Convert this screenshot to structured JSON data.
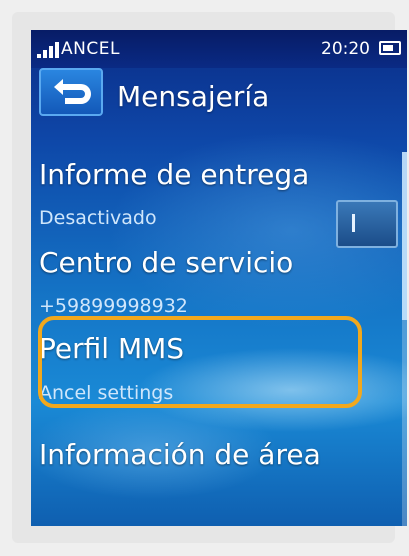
{
  "status_bar": {
    "carrier": "ANCEL",
    "time": "20:20",
    "signal_icon": "signal-bars-icon",
    "battery_icon": "battery-icon"
  },
  "header": {
    "title": "Mensajería",
    "back_icon": "back-arrow-icon"
  },
  "settings": [
    {
      "title": "Informe de entrega",
      "value": "Desactivado",
      "has_toggle": true
    },
    {
      "title": "Centro de servicio",
      "value": "+59899998932"
    },
    {
      "title": "Perfil MMS",
      "value": "Ancel settings",
      "highlighted": true
    },
    {
      "title": "Información de área",
      "value": ""
    }
  ],
  "highlight_color": "#f2a81d"
}
